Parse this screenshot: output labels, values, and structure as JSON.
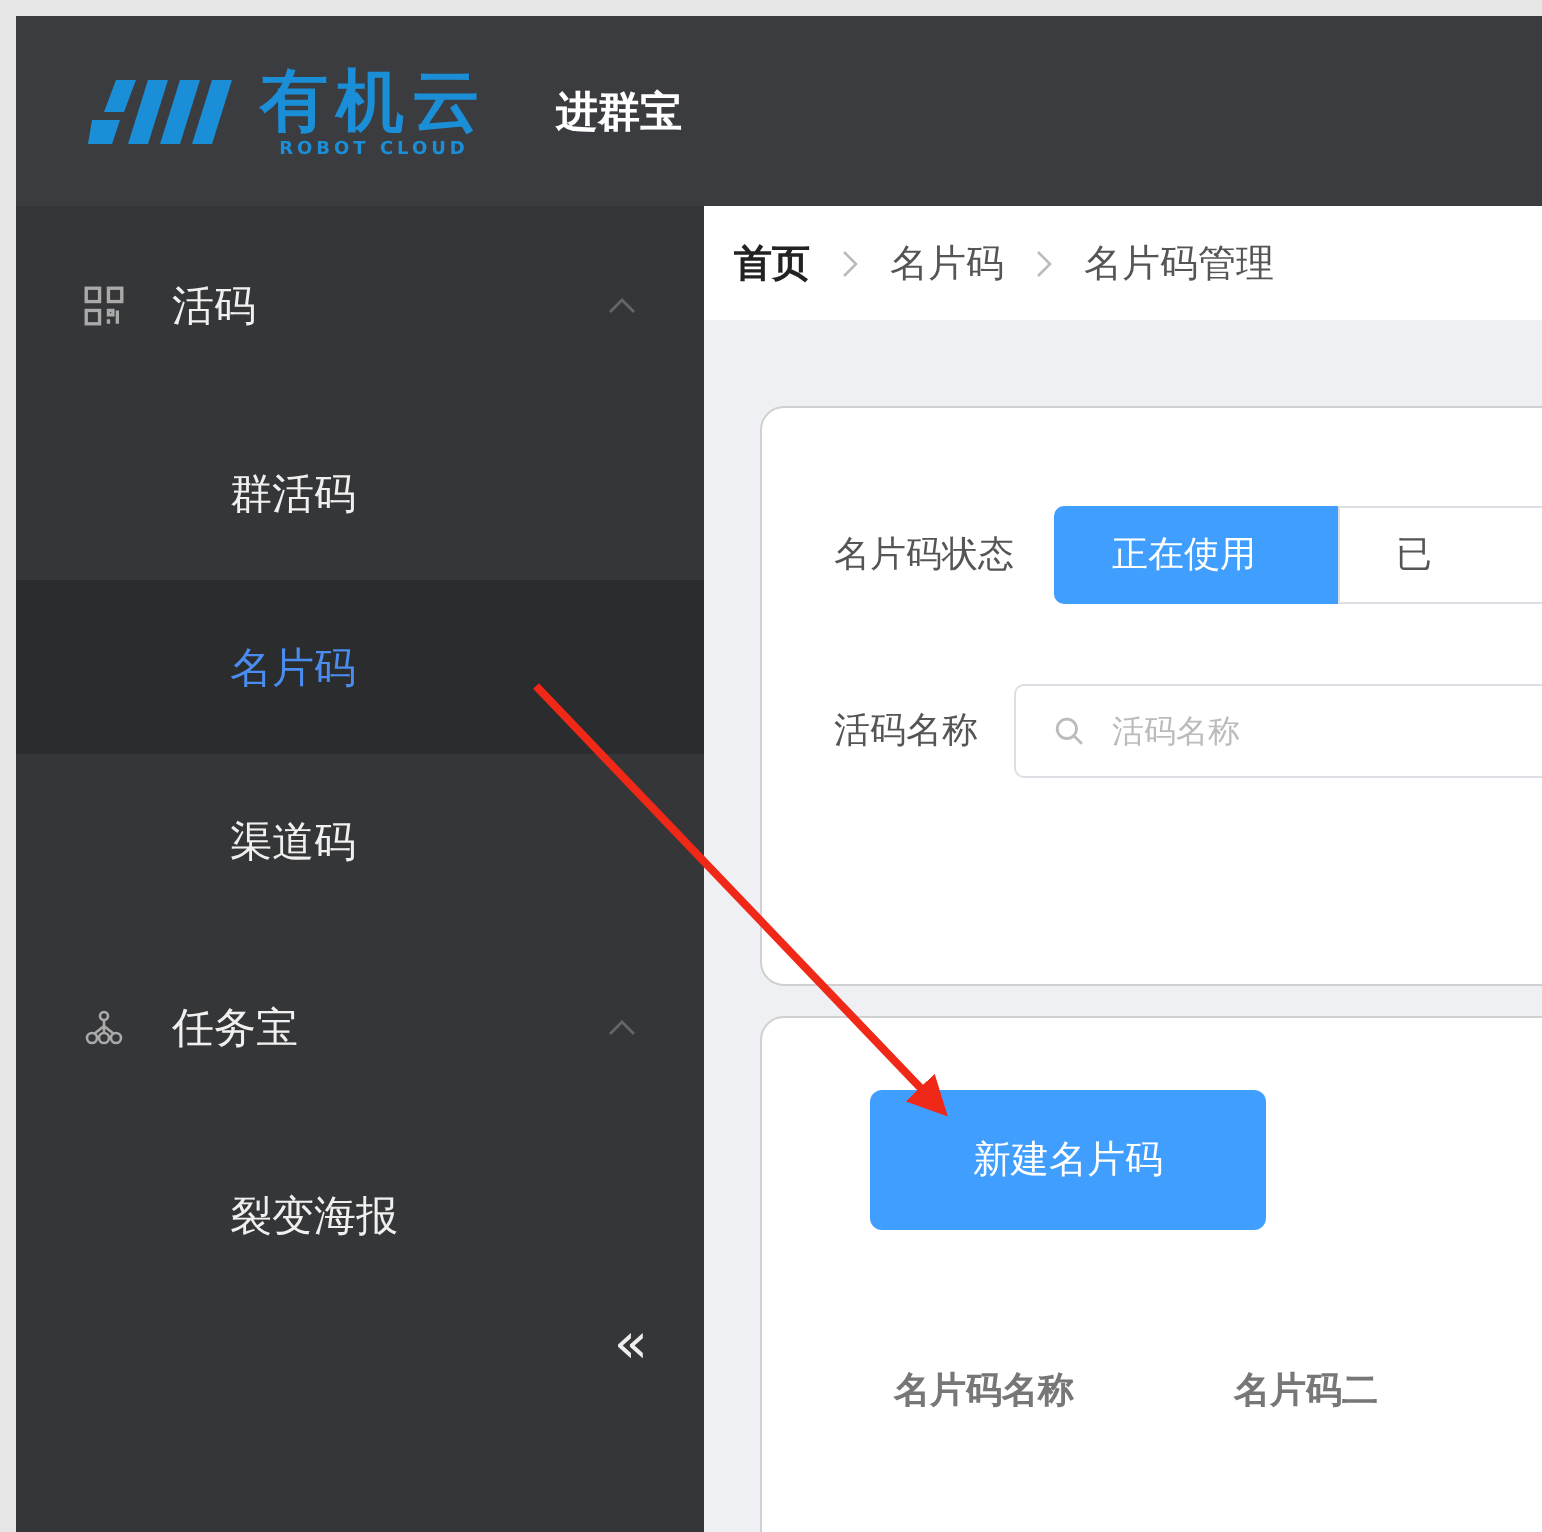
{
  "header": {
    "logo_text": "有机云",
    "logo_subtext": "ROBOT CLOUD",
    "app_name": "进群宝"
  },
  "sidebar": {
    "groups": [
      {
        "label": "活码",
        "kind": "qr",
        "expanded": true,
        "children": [
          {
            "label": "群活码",
            "selected": false
          },
          {
            "label": "名片码",
            "selected": true
          },
          {
            "label": "渠道码",
            "selected": false
          }
        ]
      },
      {
        "label": "任务宝",
        "kind": "nodes",
        "expanded": true,
        "children": [
          {
            "label": "裂变海报",
            "selected": false
          }
        ]
      }
    ],
    "collapse": "«"
  },
  "breadcrumb": [
    "首页",
    "名片码",
    "名片码管理"
  ],
  "filters": {
    "status_label": "名片码状态",
    "status_options": [
      {
        "label": "正在使用",
        "selected": true
      },
      {
        "label": "已",
        "selected": false
      }
    ],
    "name_label": "活码名称",
    "name_placeholder": "活码名称"
  },
  "new_button": "新建名片码",
  "table": {
    "columns": [
      "名片码名称",
      "名片码二"
    ]
  }
}
